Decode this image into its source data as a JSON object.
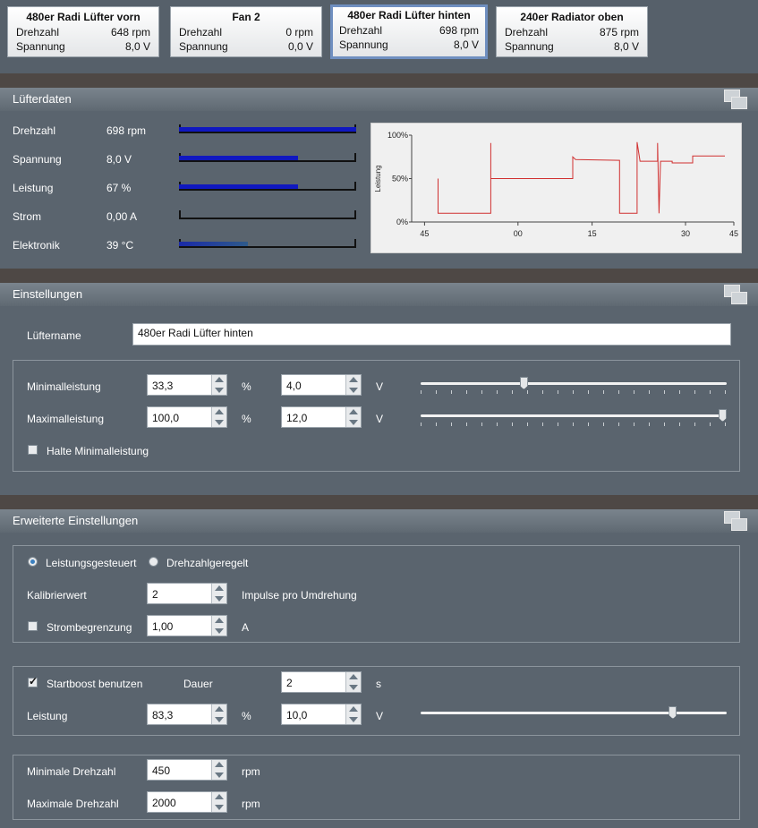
{
  "fans": [
    {
      "title": "480er Radi  Lüfter vorn",
      "speed_label": "Drehzahl",
      "speed": "648 rpm",
      "voltage_label": "Spannung",
      "voltage": "8,0 V"
    },
    {
      "title": "Fan 2",
      "speed_label": "Drehzahl",
      "speed": "0 rpm",
      "voltage_label": "Spannung",
      "voltage": "0,0 V"
    },
    {
      "title": "480er Radi Lüfter hinten",
      "speed_label": "Drehzahl",
      "speed": "698 rpm",
      "voltage_label": "Spannung",
      "voltage": "8,0 V",
      "selected": true
    },
    {
      "title": "240er Radiator oben",
      "speed_label": "Drehzahl",
      "speed": "875 rpm",
      "voltage_label": "Spannung",
      "voltage": "8,0 V"
    }
  ],
  "fandata": {
    "header": "Lüfterdaten",
    "rows": [
      {
        "label": "Drehzahl",
        "value": "698 rpm",
        "fill": 1.0
      },
      {
        "label": "Spannung",
        "value": "8,0 V",
        "fill": 0.67
      },
      {
        "label": "Leistung",
        "value": "67 %",
        "fill": 0.67
      },
      {
        "label": "Strom",
        "value": "0,00 A",
        "fill": 0.0
      },
      {
        "label": "Elektronik",
        "value": "39 °C",
        "fill": 0.39
      }
    ]
  },
  "chart_data": {
    "type": "line",
    "title": "",
    "xlabel": "",
    "ylabel": "Leistung",
    "yticks": [
      "0%",
      "50%",
      "100%"
    ],
    "xticks": [
      "45",
      "00",
      "15",
      "30",
      "45"
    ],
    "ylim": [
      0,
      100
    ],
    "color": "#d03030",
    "series": [
      {
        "values": [
          [
            0.02,
            50
          ],
          [
            0.02,
            10
          ],
          [
            0.2,
            10
          ],
          [
            0.2,
            91
          ],
          [
            0.2,
            50
          ],
          [
            0.48,
            50
          ],
          [
            0.48,
            75
          ],
          [
            0.49,
            72
          ],
          [
            0.64,
            71
          ],
          [
            0.64,
            10
          ],
          [
            0.7,
            10
          ],
          [
            0.7,
            92
          ],
          [
            0.71,
            70
          ],
          [
            0.77,
            70
          ],
          [
            0.77,
            91
          ],
          [
            0.775,
            10
          ],
          [
            0.78,
            70
          ],
          [
            0.82,
            70
          ],
          [
            0.82,
            68
          ],
          [
            0.89,
            68
          ],
          [
            0.89,
            76
          ],
          [
            1.0,
            76
          ]
        ]
      }
    ]
  },
  "settings": {
    "header": "Einstellungen",
    "name_label": "Lüftername",
    "name_value": "480er Radi Lüfter hinten",
    "min_label": "Minimalleistung",
    "min_percent": "33,3",
    "min_volt": "4,0",
    "max_label": "Maximalleistung",
    "max_percent": "100,0",
    "max_volt": "12,0",
    "percent_unit": "%",
    "volt_unit": "V",
    "min_slider": 0.333,
    "max_slider": 1.0,
    "hold_min_label": "Halte Minimalleistung",
    "hold_min_checked": false
  },
  "advanced": {
    "header": "Erweiterte Einstellungen",
    "mode_power": "Leistungsgesteuert",
    "mode_speed": "Drehzahlgeregelt",
    "calib_label": "Kalibrierwert",
    "calib_value": "2",
    "calib_unit": "Impulse pro Umdrehung",
    "current_limit_label": "Strombegrenzung",
    "current_limit_value": "1,00",
    "current_unit": "A",
    "boost_label": "Startboost benutzen",
    "duration_label": "Dauer",
    "duration_value": "2",
    "duration_unit": "s",
    "boost_power_label": "Leistung",
    "boost_percent": "83,3",
    "boost_volt": "10,0",
    "boost_slider": 0.833,
    "min_rpm_label": "Minimale Drehzahl",
    "min_rpm_value": "450",
    "max_rpm_label": "Maximale Drehzahl",
    "max_rpm_value": "2000",
    "rpm_unit": "rpm"
  }
}
